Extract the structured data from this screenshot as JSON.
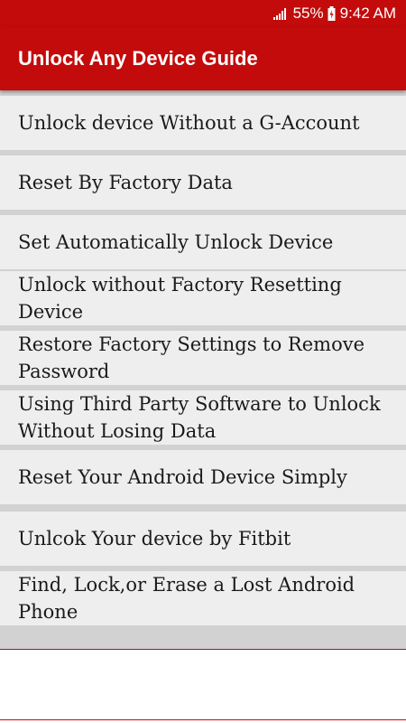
{
  "status_bar": {
    "battery": "55%",
    "time": "9:42 AM",
    "signal_icon": "signal-icon",
    "battery_icon": "battery-charging-icon"
  },
  "app_bar": {
    "title": "Unlock Any Device Guide",
    "color": "#c30b0b"
  },
  "items": [
    {
      "label": "Unlock device Without a G-Account"
    },
    {
      "label": "Reset By Factory Data"
    },
    {
      "label": "Set Automatically Unlock Device"
    },
    {
      "label": "Unlock without Factory Resetting Device"
    },
    {
      "label": "Restore Factory Settings to Remove Password"
    },
    {
      "label": "Using Third Party Software to Unlock Without Losing Data"
    },
    {
      "label": "Reset Your Android Device Simply"
    },
    {
      "label": "Unlcok Your device by Fitbit"
    },
    {
      "label": "Find, Lock,or Erase a Lost Android Phone"
    }
  ]
}
